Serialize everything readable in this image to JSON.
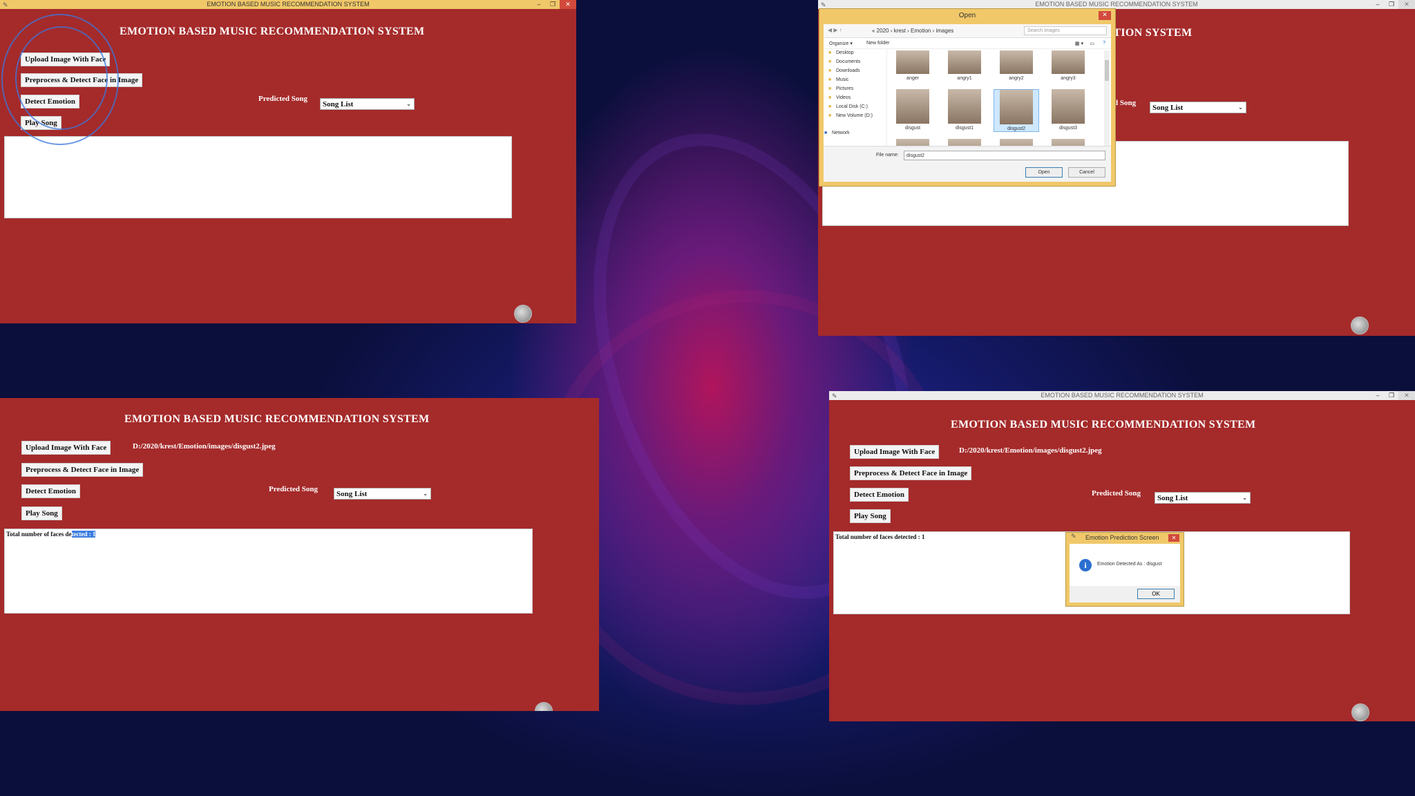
{
  "app": {
    "window_title": "EMOTION BASED MUSIC RECOMMENDATION SYSTEM",
    "heading": "EMOTION BASED MUSIC RECOMMENDATION SYSTEM",
    "buttons": {
      "upload": "Upload Image With Face",
      "preprocess": "Preprocess & Detect Face in Image",
      "detect": "Detect Emotion",
      "play": "Play Song"
    },
    "predicted_song_label": "Predicted Song",
    "predicted_song_partial": "d Song",
    "song_list_value": "Song List",
    "file_path": "D:/2020/krest/Emotion/images/disgust2.jpeg",
    "faces_text_prefix": "Total number of faces de",
    "faces_text_selected": "tected : 1",
    "faces_text_full": "Total number of faces detected : 1"
  },
  "open_dialog": {
    "title": "Open",
    "breadcrumbs": "« 2020 › krest › Emotion › images",
    "search_placeholder": "Search images",
    "organize": "Organize ▾",
    "new_folder": "New folder",
    "nav_items": [
      "Desktop",
      "Documents",
      "Downloads",
      "Music",
      "Pictures",
      "Videos",
      "Local Disk (C:)",
      "New Volume (D:)"
    ],
    "network": "Network",
    "thumbs": [
      "anger",
      "angry1",
      "angry2",
      "angry3",
      "disgust",
      "disgust1",
      "disgust2",
      "disgust3"
    ],
    "file_name_label": "File name:",
    "file_name_value": "disgust2",
    "open_btn": "Open",
    "cancel_btn": "Cancel"
  },
  "message_box": {
    "title": "Emotion Prediction Screen",
    "text": "Emotion Detected As : disgust",
    "ok": "OK"
  }
}
